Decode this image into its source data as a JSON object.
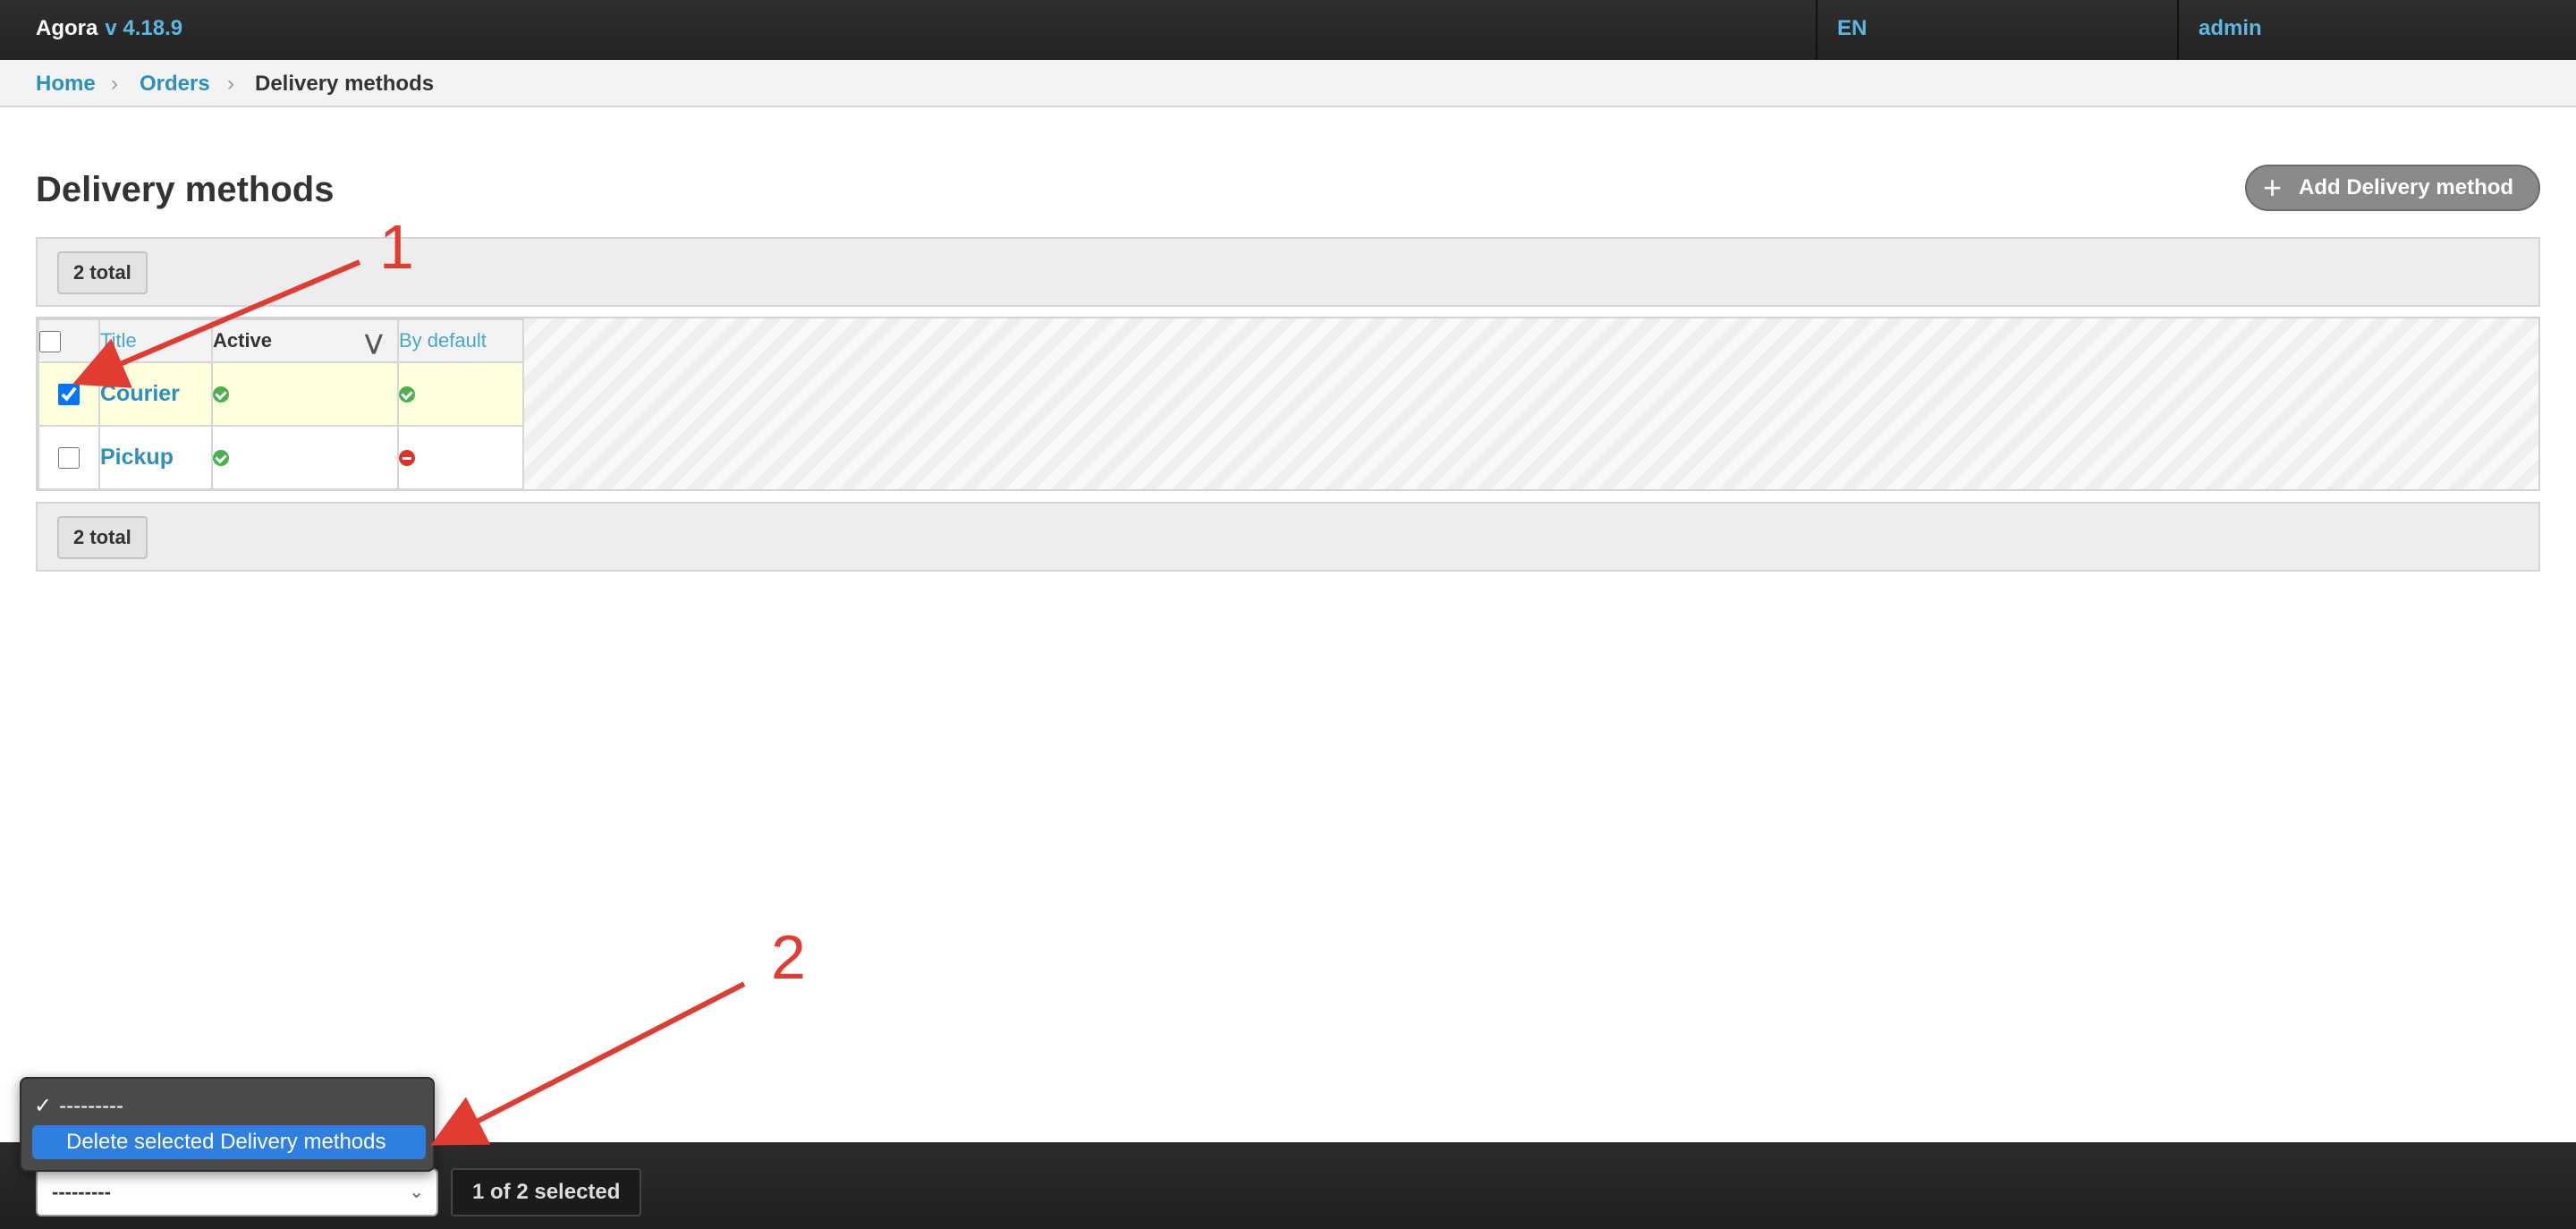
{
  "header": {
    "brand": "Agora",
    "version": "v 4.18.9",
    "language": "EN",
    "user": "admin"
  },
  "breadcrumbs": [
    {
      "label": "Home"
    },
    {
      "label": "Orders"
    },
    {
      "label": "Delivery methods"
    }
  ],
  "page": {
    "title": "Delivery methods",
    "add_button": "Add Delivery method"
  },
  "toolbar": {
    "total_label": "2 total"
  },
  "table": {
    "columns": [
      "Title",
      "Active",
      "By default"
    ],
    "rows": [
      {
        "title": "Courier",
        "active": "yes",
        "by_default": "yes",
        "selected": true
      },
      {
        "title": "Pickup",
        "active": "yes",
        "by_default": "no",
        "selected": false
      }
    ]
  },
  "actions": {
    "current_value": "---------",
    "options": [
      "---------",
      "Delete selected Delivery methods"
    ],
    "selected_count": "1 of 2 selected"
  },
  "annotations": [
    "1",
    "2"
  ],
  "colors": {
    "header_bg": "#262626",
    "link": "#2b8fc1",
    "accent": "#5cb8e0",
    "arrow": "#e03c31",
    "dropdown_highlight": "#2e7fe0",
    "row_selected": "#ffffdd"
  }
}
